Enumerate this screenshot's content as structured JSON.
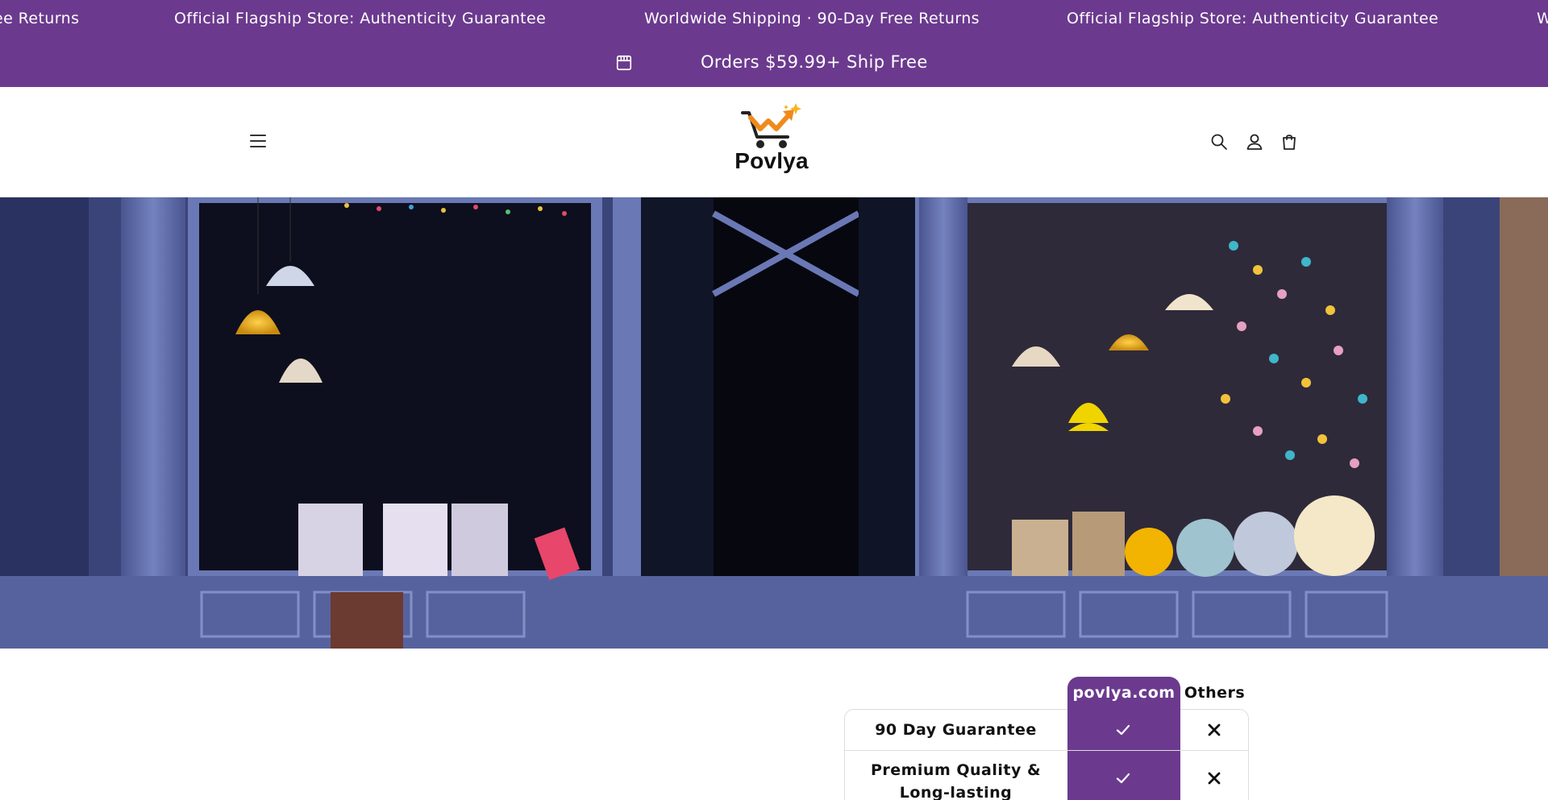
{
  "announcement": {
    "marquee": [
      "ee Returns",
      "Official Flagship Store: Authenticity Guarantee",
      "Worldwide Shipping · 90-Day Free Returns",
      "Official Flagship Store: Authenticity Guarantee",
      "W"
    ],
    "shipping_text": "Orders $59.99+ Ship Free",
    "shipping_icon": "store-icon",
    "background_color": "#6b3a8e"
  },
  "header": {
    "logo_text": "Povlya",
    "menu_icon": "hamburger-menu-icon",
    "search_icon": "search-icon",
    "account_icon": "account-icon",
    "cart_icon": "shopping-bag-icon"
  },
  "hero": {
    "image_description_icon": "storefront-photo"
  },
  "comparison": {
    "brand_column": "povlya.com",
    "others_column": "Others",
    "rows": [
      {
        "feature": "90 Day Guarantee",
        "brand": "check",
        "others": "cross"
      },
      {
        "feature": "Premium Quality & Long-lasting",
        "brand": "check",
        "others": "cross"
      }
    ],
    "accent_color": "#6b3a8e"
  }
}
